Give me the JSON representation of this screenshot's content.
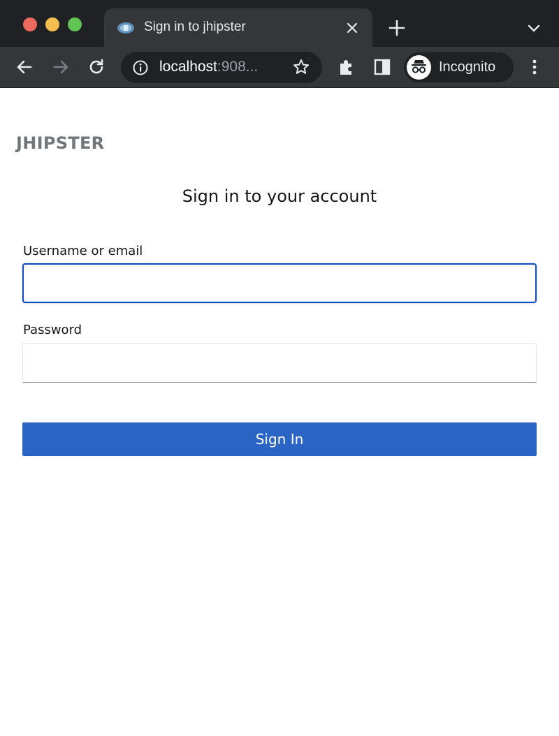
{
  "browser": {
    "tab": {
      "title": "Sign in to jhipster",
      "favicon": "jhipster-favicon-icon"
    },
    "omnibox": {
      "host": "localhost",
      "port_truncated": ":908..."
    },
    "profile": {
      "label": "Incognito",
      "icon": "incognito-icon"
    },
    "icons": [
      "back-arrow-icon",
      "forward-arrow-icon",
      "reload-icon",
      "info-icon",
      "star-icon",
      "extensions-icon",
      "side-panel-icon",
      "kebab-menu-icon",
      "close-icon",
      "plus-icon",
      "chevron-down-icon"
    ]
  },
  "page": {
    "brand": "JHIPSTER",
    "heading": "Sign in to your account",
    "username_label": "Username or email",
    "username_value": "",
    "password_label": "Password",
    "password_value": "",
    "submit_label": "Sign In"
  },
  "colors": {
    "primary_button": "#2a65c6",
    "focus_border": "#0f4ebc",
    "brand_text": "#737679",
    "chrome_dark": "#202124",
    "chrome_toolbar": "#35363a"
  }
}
